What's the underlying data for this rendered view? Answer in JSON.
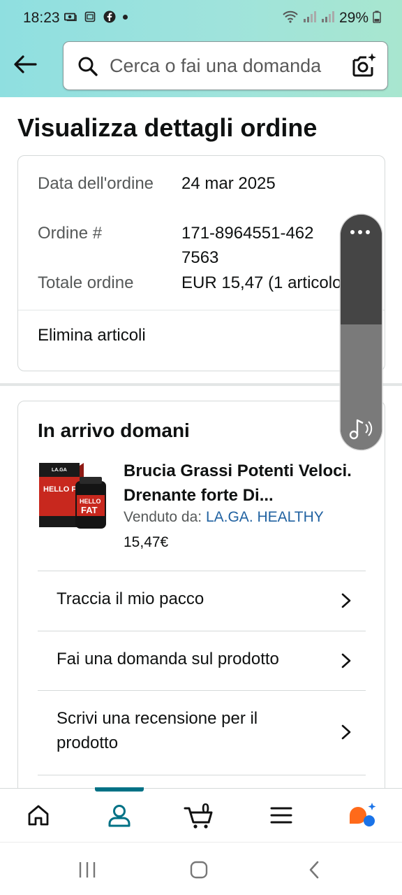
{
  "status_bar": {
    "time": "18:23",
    "battery": "29%"
  },
  "search": {
    "placeholder": "Cerca o fai una domanda"
  },
  "page": {
    "title": "Visualizza dettagli ordine"
  },
  "order_summary": {
    "rows": [
      {
        "label": "Data dell'ordine",
        "value": "24 mar 2025"
      },
      {
        "label": "Ordine #",
        "value": "171-8964551-4627563"
      },
      {
        "label": "Totale ordine",
        "value": "EUR 15,47 (1 articolo)"
      }
    ],
    "delete_items": "Elimina articoli"
  },
  "arriving": {
    "title": "In arrivo domani",
    "product": {
      "title": "Brucia Grassi Potenti Veloci. Drenante forte Di...",
      "sold_by_label": "Venduto da: ",
      "seller": "LA.GA. HEALTHY",
      "price": "15,47€",
      "image_text": "HELLO FAT"
    },
    "actions": [
      {
        "label": "Traccia il mio pacco"
      },
      {
        "label": "Fai una domanda sul prodotto"
      },
      {
        "label": "Scrivi una recensione per il prodotto"
      }
    ]
  },
  "bottom_nav": {
    "items": [
      "home-icon",
      "account-icon",
      "cart-icon",
      "menu-icon",
      "rufus-icon"
    ],
    "active": "account-icon",
    "cart_count": "0"
  },
  "colors": {
    "header_gradient_start": "#8fdfe0",
    "header_gradient_end": "#a8e6cf",
    "link": "#2162a1",
    "active_nav": "#007185",
    "ai_orange": "#ff6a1a",
    "ai_blue": "#1a73e8"
  }
}
